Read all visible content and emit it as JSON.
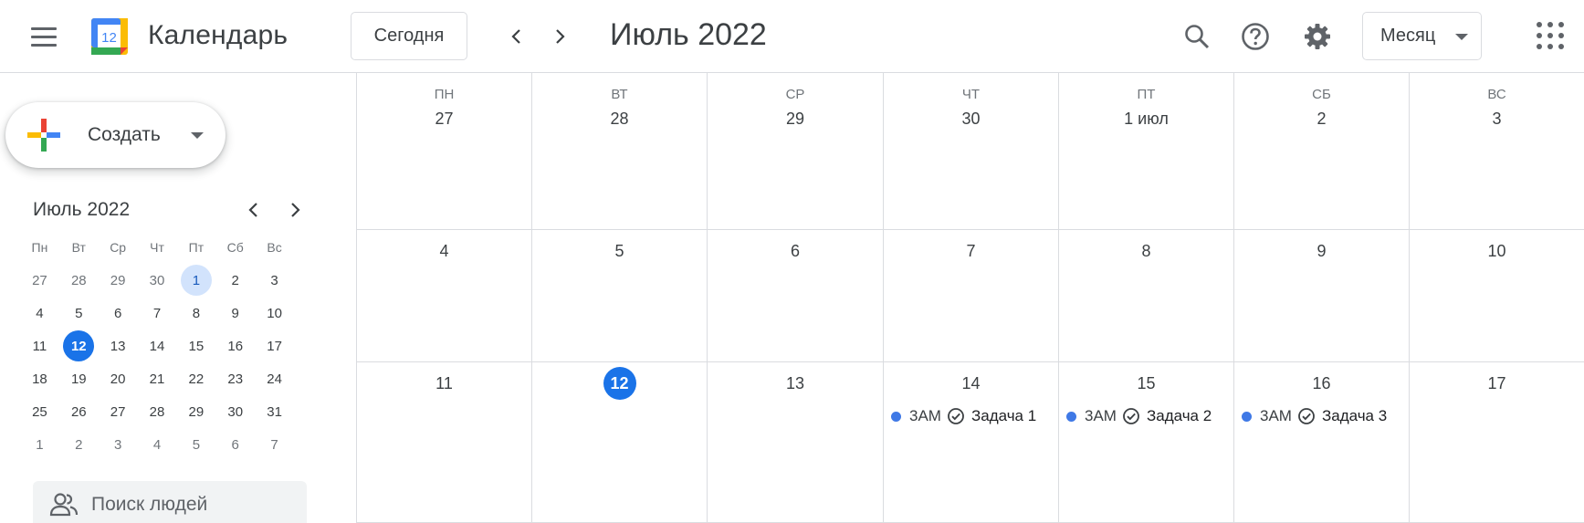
{
  "header": {
    "menu_icon": "hamburger-menu-icon",
    "logo_date": "12",
    "app_title": "Календарь",
    "today_label": "Сегодня",
    "period_title": "Июль 2022",
    "view_label": "Месяц",
    "icons": [
      "search-icon",
      "help-icon",
      "gear-icon",
      "apps-grid-icon"
    ]
  },
  "sidebar": {
    "create_label": "Создать",
    "mini": {
      "title": "Июль 2022",
      "dow": [
        "Пн",
        "Вт",
        "Ср",
        "Чт",
        "Пт",
        "Сб",
        "Вс"
      ],
      "weeks": [
        [
          "27",
          "28",
          "29",
          "30",
          "1",
          "2",
          "3"
        ],
        [
          "4",
          "5",
          "6",
          "7",
          "8",
          "9",
          "10"
        ],
        [
          "11",
          "12",
          "13",
          "14",
          "15",
          "16",
          "17"
        ],
        [
          "18",
          "19",
          "20",
          "21",
          "22",
          "23",
          "24"
        ],
        [
          "25",
          "26",
          "27",
          "28",
          "29",
          "30",
          "31"
        ],
        [
          "1",
          "2",
          "3",
          "4",
          "5",
          "6",
          "7"
        ]
      ],
      "selected_day": "1",
      "today_day": "12"
    },
    "people_search_placeholder": "Поиск людей"
  },
  "month": {
    "dow": [
      "ПН",
      "ВТ",
      "СР",
      "ЧТ",
      "ПТ",
      "СБ",
      "ВС"
    ],
    "weeks": [
      [
        "27",
        "28",
        "29",
        "30",
        "1 июл",
        "2",
        "3"
      ],
      [
        "4",
        "5",
        "6",
        "7",
        "8",
        "9",
        "10"
      ],
      [
        "11",
        "12",
        "13",
        "14",
        "15",
        "16",
        "17"
      ]
    ],
    "today_day": "12",
    "events": [
      {
        "day": "14",
        "time": "3АМ",
        "title": "Задача 1",
        "color": "#3f79e6"
      },
      {
        "day": "15",
        "time": "3АМ",
        "title": "Задача 2",
        "color": "#3f79e6"
      },
      {
        "day": "16",
        "time": "3АМ",
        "title": "Задача 3",
        "color": "#3f79e6"
      }
    ]
  },
  "colors": {
    "accent": "#1a73e8",
    "selected_bg": "#d2e3fc",
    "event_dot": "#3f79e6",
    "border": "#dadce0"
  }
}
